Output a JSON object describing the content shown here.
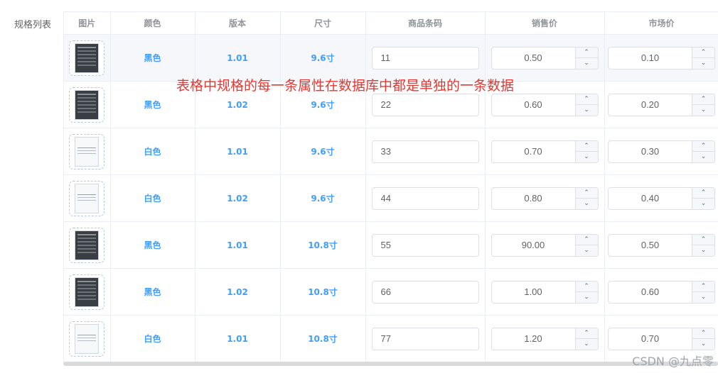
{
  "form": {
    "label": "规格列表"
  },
  "table": {
    "headers": [
      "图片",
      "颜色",
      "版本",
      "尺寸",
      "商品条码",
      "销售价",
      "市场价"
    ],
    "rows": [
      {
        "image": "dark-device-thumbnail",
        "color": "黑色",
        "version": "1.01",
        "size": "9.6寸",
        "barcode": "11",
        "sale_price": "0.50",
        "market_price": "0.10"
      },
      {
        "image": "dark-device-thumbnail",
        "color": "黑色",
        "version": "1.02",
        "size": "9.6寸",
        "barcode": "22",
        "sale_price": "0.60",
        "market_price": "0.20"
      },
      {
        "image": "light-device-thumbnail",
        "color": "白色",
        "version": "1.01",
        "size": "9.6寸",
        "barcode": "33",
        "sale_price": "0.70",
        "market_price": "0.30"
      },
      {
        "image": "light-device-thumbnail",
        "color": "白色",
        "version": "1.02",
        "size": "9.6寸",
        "barcode": "44",
        "sale_price": "0.80",
        "market_price": "0.40"
      },
      {
        "image": "dark-device-thumbnail",
        "color": "黑色",
        "version": "1.01",
        "size": "10.8寸",
        "barcode": "55",
        "sale_price": "90.00",
        "market_price": "0.50"
      },
      {
        "image": "dark-device-thumbnail",
        "color": "黑色",
        "version": "1.02",
        "size": "10.8寸",
        "barcode": "66",
        "sale_price": "1.00",
        "market_price": "0.60"
      },
      {
        "image": "light-device-thumbnail",
        "color": "白色",
        "version": "1.01",
        "size": "10.8寸",
        "barcode": "77",
        "sale_price": "1.20",
        "market_price": "0.70"
      }
    ]
  },
  "annotation": "表格中规格的每一条属性在数据库中都是单独的一条数据",
  "watermark": "CSDN @九点零",
  "colors": {
    "accent": "#409eff",
    "annotation": "#e8362f",
    "border": "#ebeef5"
  },
  "icons": {
    "spin_up": "chevron-up-icon",
    "spin_down": "chevron-down-icon"
  }
}
